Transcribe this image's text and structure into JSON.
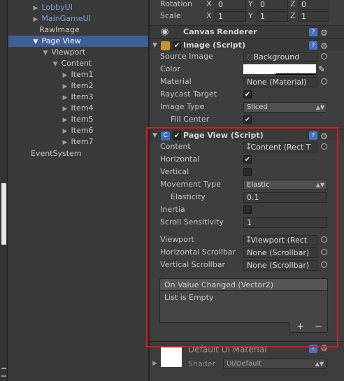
{
  "hierarchy": {
    "items": [
      {
        "label": "LobbyUI",
        "arrow": "▶",
        "style": "link"
      },
      {
        "label": "MainGameUI",
        "arrow": "▶",
        "style": "link"
      },
      {
        "label": "RawImage",
        "arrow": "",
        "style": "normal"
      },
      {
        "label": "Page View",
        "arrow": "▼",
        "style": "selected"
      },
      {
        "label": "Viewport",
        "arrow": "▼",
        "style": "normal"
      },
      {
        "label": "Content",
        "arrow": "▼",
        "style": "normal"
      },
      {
        "label": "Item1",
        "arrow": "▶",
        "style": "normal"
      },
      {
        "label": "Item2",
        "arrow": "▶",
        "style": "normal"
      },
      {
        "label": "Item3",
        "arrow": "▶",
        "style": "normal"
      },
      {
        "label": "Item4",
        "arrow": "▶",
        "style": "normal"
      },
      {
        "label": "Item5",
        "arrow": "▶",
        "style": "normal"
      },
      {
        "label": "Item6",
        "arrow": "▶",
        "style": "normal"
      },
      {
        "label": "Item7",
        "arrow": "▶",
        "style": "normal"
      },
      {
        "label": "EventSystem",
        "arrow": "",
        "style": "normal"
      }
    ]
  },
  "transform": {
    "rotation_label": "Rotation",
    "scale_label": "Scale",
    "x": "X",
    "y": "Y",
    "z": "Z",
    "rotation": [
      "0",
      "0",
      "0"
    ],
    "scale": [
      "1",
      "1",
      "1"
    ]
  },
  "canvas_renderer": {
    "title": "Canvas Renderer",
    "icon": "eye-icon"
  },
  "image_script": {
    "title": "Image (Script)",
    "source_image_label": "Source Image",
    "source_image_value": "Background",
    "color_label": "Color",
    "material_label": "Material",
    "material_value": "None (Material)",
    "raycast_label": "Raycast Target",
    "image_type_label": "Image Type",
    "image_type_value": "Sliced",
    "fill_center_label": "Fill Center"
  },
  "page_view_script": {
    "title": "Page View (Script)",
    "content_label": "Content",
    "content_value": "Content (Rect T",
    "horizontal_label": "Horizontal",
    "horizontal_checked": true,
    "vertical_label": "Vertical",
    "vertical_checked": false,
    "movement_type_label": "Movement Type",
    "movement_type_value": "Elastic",
    "elasticity_label": "Elasticity",
    "elasticity_value": "0.1",
    "inertia_label": "Inertia",
    "inertia_checked": false,
    "scroll_sensitivity_label": "Scroll Sensitivity",
    "scroll_sensitivity_value": "1",
    "viewport_label": "Viewport",
    "viewport_value": "Viewport (Rect",
    "h_scrollbar_label": "Horizontal Scrollbar",
    "h_scrollbar_value": "None (Scrollbar)",
    "v_scrollbar_label": "Vertical Scrollbar",
    "v_scrollbar_value": "None (Scrollbar)",
    "event_title": "On Value Changed (Vector2)",
    "event_empty": "List is Empty",
    "add_label": "+",
    "remove_label": "−"
  },
  "material_section": {
    "title": "Default UI Material",
    "shader_label": "Shader",
    "shader_value": "UI/Default"
  },
  "colors": {
    "selection": "#3e5f96",
    "highlight_frame": "#d6191e",
    "help_icon": "#4873c4"
  }
}
